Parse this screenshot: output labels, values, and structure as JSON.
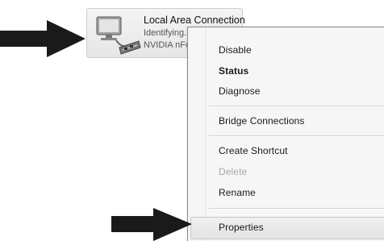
{
  "adapter": {
    "name": "Local Area Connection",
    "status": "Identifying...",
    "device": "NVIDIA nForce Networking Controller",
    "icon": "network-adapter-icon"
  },
  "context_menu": {
    "items": [
      {
        "label": "Disable",
        "style": "normal"
      },
      {
        "label": "Status",
        "style": "bold"
      },
      {
        "label": "Diagnose",
        "style": "normal"
      },
      {
        "label": "Bridge Connections",
        "style": "normal"
      },
      {
        "label": "Create Shortcut",
        "style": "normal"
      },
      {
        "label": "Delete",
        "style": "disabled"
      },
      {
        "label": "Rename",
        "style": "normal"
      },
      {
        "label": "Properties",
        "style": "highlighted"
      }
    ]
  },
  "annotations": {
    "arrow_icon": "right-arrow-icon",
    "arrow_color": "#1a1a1a"
  }
}
